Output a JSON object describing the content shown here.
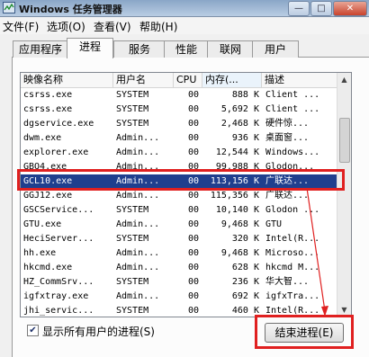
{
  "window": {
    "title": "Windows 任务管理器",
    "controls": [
      "—",
      "□",
      "✕"
    ]
  },
  "menu": [
    "文件(F)",
    "选项(O)",
    "查看(V)",
    "帮助(H)"
  ],
  "tabs": [
    "应用程序",
    "进程",
    "服务",
    "性能",
    "联网",
    "用户"
  ],
  "active_tab": "进程",
  "table": {
    "columns": [
      "映像名称",
      "用户名",
      "CPU",
      "内存(...",
      "描述"
    ],
    "rows": [
      {
        "name": "csrss.exe",
        "user": "SYSTEM",
        "cpu": "00",
        "mem": "888 K",
        "desc": "Client ..."
      },
      {
        "name": "csrss.exe",
        "user": "SYSTEM",
        "cpu": "00",
        "mem": "5,692 K",
        "desc": "Client ..."
      },
      {
        "name": "dgservice.exe",
        "user": "SYSTEM",
        "cpu": "00",
        "mem": "2,468 K",
        "desc": "硬件惊..."
      },
      {
        "name": "dwm.exe",
        "user": "Admin...",
        "cpu": "00",
        "mem": "936 K",
        "desc": "桌面窗..."
      },
      {
        "name": "explorer.exe",
        "user": "Admin...",
        "cpu": "00",
        "mem": "12,544 K",
        "desc": "Windows..."
      },
      {
        "name": "GBQ4.exe",
        "user": "Admin...",
        "cpu": "00",
        "mem": "99,988 K",
        "desc": "Glodon..."
      },
      {
        "name": "GCL10.exe",
        "user": "Admin...",
        "cpu": "00",
        "mem": "113,156 K",
        "desc": "广联达..."
      },
      {
        "name": "GGJ12.exe",
        "user": "Admin...",
        "cpu": "00",
        "mem": "115,356 K",
        "desc": "广联达..."
      },
      {
        "name": "GSCService...",
        "user": "SYSTEM",
        "cpu": "00",
        "mem": "10,140 K",
        "desc": "Glodon ..."
      },
      {
        "name": "GTU.exe",
        "user": "Admin...",
        "cpu": "00",
        "mem": "9,468 K",
        "desc": "GTU"
      },
      {
        "name": "HeciServer...",
        "user": "SYSTEM",
        "cpu": "00",
        "mem": "320 K",
        "desc": "Intel(R..."
      },
      {
        "name": "hh.exe",
        "user": "Admin...",
        "cpu": "00",
        "mem": "9,468 K",
        "desc": "Microso..."
      },
      {
        "name": "hkcmd.exe",
        "user": "Admin...",
        "cpu": "00",
        "mem": "628 K",
        "desc": "hkcmd M..."
      },
      {
        "name": "HZ_CommSrv...",
        "user": "SYSTEM",
        "cpu": "00",
        "mem": "236 K",
        "desc": "华大智..."
      },
      {
        "name": "igfxtray.exe",
        "user": "Admin...",
        "cpu": "00",
        "mem": "692 K",
        "desc": "igfxTra..."
      },
      {
        "name": "jhi_servic...",
        "user": "SYSTEM",
        "cpu": "00",
        "mem": "460 K",
        "desc": "Intel(R..."
      }
    ],
    "selected_row": 6
  },
  "show_all_users": {
    "label": "显示所有用户的进程(S)",
    "checked": true,
    "mark": "✔"
  },
  "end_process_button": "结束进程(E)",
  "colors": {
    "highlight": "#e02020",
    "selection": "#1f3f8e"
  }
}
